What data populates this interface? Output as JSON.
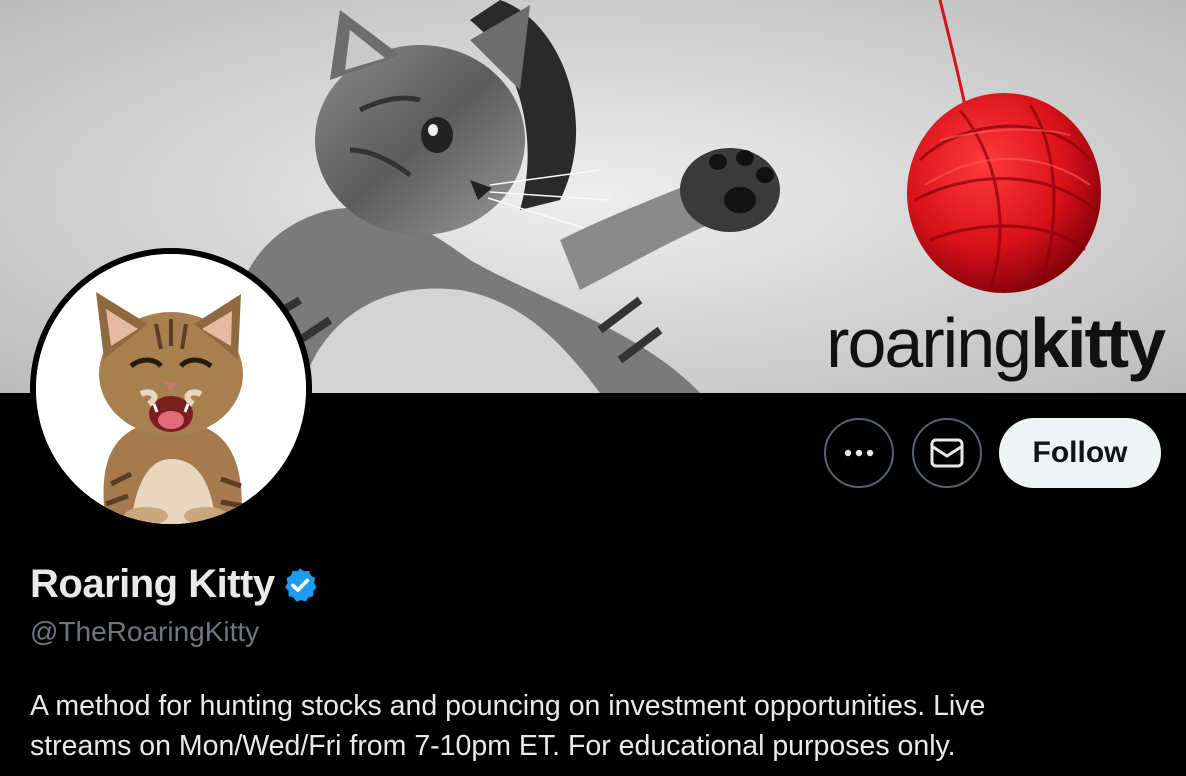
{
  "banner": {
    "wordmark_thin": "roaring",
    "wordmark_bold": "kitty"
  },
  "profile": {
    "display_name": "Roaring Kitty",
    "verified": true,
    "handle": "@TheRoaringKitty",
    "bio_line1": "A method for hunting stocks and pouncing on investment opportunities. Live",
    "bio_line2": "streams on Mon/Wed/Fri from 7-10pm ET. For educational purposes only."
  },
  "actions": {
    "more_icon": "more-horizontal-icon",
    "message_icon": "envelope-icon",
    "follow_label": "Follow"
  },
  "colors": {
    "background": "#000000",
    "text_primary": "#e7e9ea",
    "text_secondary": "#71767b",
    "verified_blue": "#1d9bf0",
    "follow_bg": "#eff3f4",
    "yarn_red": "#d8111a"
  }
}
